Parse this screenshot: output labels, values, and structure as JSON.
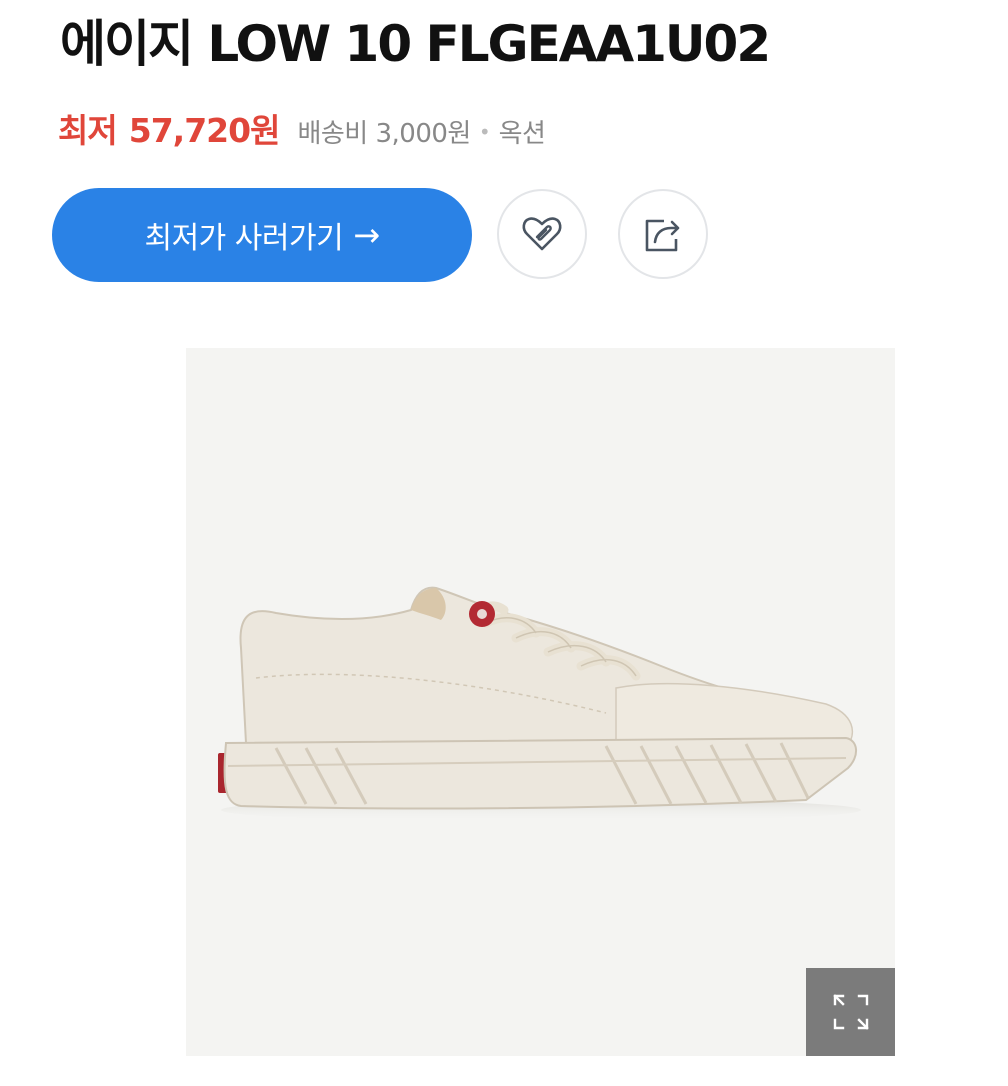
{
  "product": {
    "title": "에이지 LOW 10 FLGEAA1U02"
  },
  "price": {
    "label": "최저",
    "value": "57,720원",
    "shipping": "배송비 3,000원",
    "separator": "•",
    "seller": "옥션"
  },
  "actions": {
    "buy_label": "최저가 사러가기",
    "buy_arrow": "→",
    "like_icon": "heart-icon",
    "share_icon": "share-icon"
  },
  "image": {
    "alt": "에이지 LOW 10 FLGEAA1U02",
    "expand_icon": "expand-icon"
  },
  "colors": {
    "accent": "#2a82e6",
    "price": "#e0463a",
    "muted": "#888888"
  }
}
